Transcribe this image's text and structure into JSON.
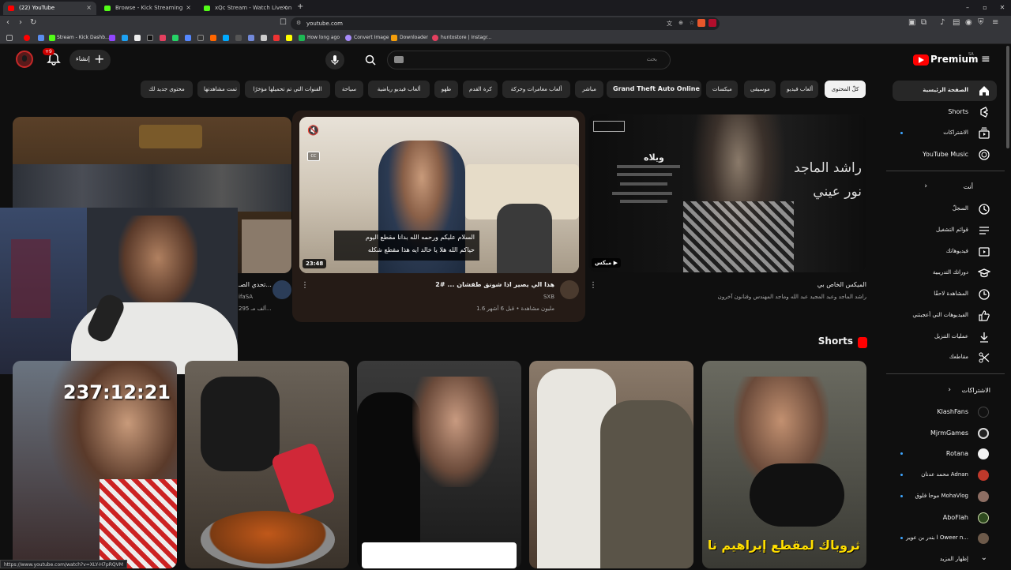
{
  "browser": {
    "tabs": [
      {
        "label": "(22) YouTube",
        "close": "×"
      },
      {
        "label": "Browse - Kick Streaming",
        "close": "×"
      },
      {
        "label": "xQc Stream - Watch Live on Kick",
        "close": "×"
      }
    ],
    "new_tab": "+",
    "window_controls": [
      "–",
      "▫",
      "✕"
    ],
    "url": "youtube.com",
    "bookmarks": [
      "Stream - Kick Dashb...",
      "How long ago",
      "Convert Image",
      "Downloader",
      "huntostore | Instagr..."
    ],
    "status_url": "https://www.youtube.com/watch?v=XLY-H7pRQVM"
  },
  "header": {
    "logo_text": "Premium",
    "logo_region": "SA",
    "search_placeholder": "بحث",
    "create_label": "إنشاء",
    "notif_count": "+9"
  },
  "chips": [
    "كلّ المحتوى",
    "ألعاب فيديو",
    "موسيقى",
    "ميكسات",
    "Grand Theft Auto Online",
    "مباشر",
    "ألعاب مغامرات وحركة",
    "كرة القدم",
    "طهو",
    "ألعاب فيديو رياضية",
    "سياحة",
    "القنوات التي تم تحميلها مؤخرًا",
    "تمت مشاهدتها",
    "محتوى جديد لك"
  ],
  "sidebar": {
    "main": [
      "الصفحة الرئيسية",
      "Shorts",
      "الاشتراكات",
      "YouTube Music"
    ],
    "you_header": "أنت",
    "you": [
      "السجلّ",
      "قوائم التشغيل",
      "فيديوهاتك",
      "دوراتك التدريبية",
      "المشاهدة لاحقًا",
      "الفيديوهات التي أعجبتني",
      "عمليات التنزيل",
      "مقاطعك"
    ],
    "subs_header": "الاشتراكات",
    "subs": [
      "KlashFans",
      "MjrmGames",
      "Rotana",
      "محمد عدنان Adnan",
      "موحا فلوق MohaVlog",
      "AboFlah",
      "بندر بن عوير l Oweer n..."
    ],
    "show_more": "إظهار المزيد"
  },
  "videos": [
    {
      "title": "الميكس الخاص بي",
      "meta": "راشد الماجد وعبد المجيد عبد الله وماجد المهندس وفنانون آخرون",
      "badge": "ميكس",
      "thumb_text1": "راشد الماجد",
      "thumb_text2": "نور عيني",
      "thumb_text3": "ويلاه"
    },
    {
      "title": "هذا الي يصير اذا شونق طفشان ... #2",
      "channel": "SXB",
      "meta": "1.6 مليون مشاهدة • قبل 6 أشهر",
      "duration": "23:48",
      "caption1": "السلام عليكم ورحمه الله بدانا مقطع اليوم",
      "caption2": "حياكم الله هلا يا خالد ايه هذا مقطع شكله"
    },
    {
      "title": "تحدي الصـ...",
      "channel": "ifaSA",
      "meta": "295 ألف مـ..."
    }
  ],
  "shorts": {
    "title": "Shorts",
    "items": [
      {
        "overlay": "ثروباك لمقطع إبراهيم نا"
      },
      {
        "overlay": ""
      },
      {
        "overlay": ""
      },
      {
        "overlay": ""
      },
      {
        "overlay": "237:12:21"
      }
    ]
  },
  "colors": {
    "bg": "#0f0f0f",
    "chip": "#272727",
    "accent": "#ff0000",
    "link": "#3ea6ff"
  }
}
